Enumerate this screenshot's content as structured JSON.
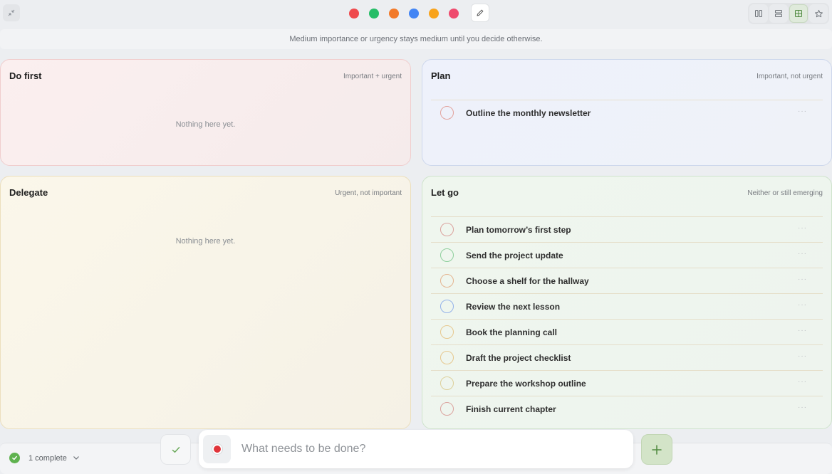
{
  "colors": {
    "dots": [
      "#ef4a4d",
      "#26bd67",
      "#f27a2a",
      "#4385f4",
      "#f8a31c",
      "#ef4a6d"
    ],
    "accent_green": "#5fb24f"
  },
  "banner": {
    "text": "Medium importance or urgency stays medium until you decide otherwise."
  },
  "quadrants": {
    "do_first": {
      "title": "Do first",
      "subtitle": "Important + urgent",
      "empty": "Nothing here yet."
    },
    "plan": {
      "title": "Plan",
      "subtitle": "Important, not urgent",
      "tasks": [
        {
          "label": "Outline the monthly newsletter",
          "circle": "#e2a39d"
        }
      ]
    },
    "delegate": {
      "title": "Delegate",
      "subtitle": "Urgent, not important",
      "empty": "Nothing here yet."
    },
    "let_go": {
      "title": "Let go",
      "subtitle": "Neither or still emerging",
      "tasks": [
        {
          "label": "Plan tomorrow’s first step",
          "circle": "#dba39e"
        },
        {
          "label": "Send the project update",
          "circle": "#8fcf9d"
        },
        {
          "label": "Choose a shelf for the hallway",
          "circle": "#e4b590"
        },
        {
          "label": "Review the next lesson",
          "circle": "#95b3e9"
        },
        {
          "label": "Book the planning call",
          "circle": "#e6c88e"
        },
        {
          "label": "Draft the project checklist",
          "circle": "#e6c88e"
        },
        {
          "label": "Prepare the workshop outline",
          "circle": "#ddd09a"
        },
        {
          "label": "Finish current chapter",
          "circle": "#dba39e"
        }
      ]
    }
  },
  "footer": {
    "complete_label": "1 complete"
  },
  "composer": {
    "placeholder": "What needs to be done?"
  }
}
